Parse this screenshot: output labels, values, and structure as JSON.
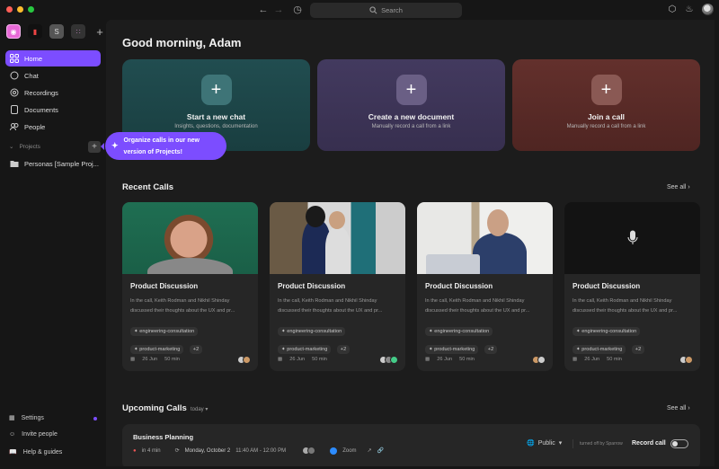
{
  "window": {
    "search_placeholder": "Search"
  },
  "colors": {
    "accent": "#7c4dff",
    "chat_card": "#1e4a4c",
    "doc_card": "#3e3558",
    "call_card": "#5a2b28"
  },
  "sidebar": {
    "items": [
      {
        "label": "Home",
        "icon": "home-grid-icon",
        "active": true
      },
      {
        "label": "Chat",
        "icon": "chat-icon"
      },
      {
        "label": "Recordings",
        "icon": "recordings-icon"
      },
      {
        "label": "Documents",
        "icon": "documents-icon"
      },
      {
        "label": "People",
        "icon": "people-icon"
      }
    ],
    "projects_label": "Projects",
    "project_items": [
      {
        "label": "Personas [Sample Proj..."
      }
    ],
    "tooltip": "Organize calls in our new version of Projects!",
    "footer": [
      {
        "label": "Settings",
        "icon": "settings-icon"
      },
      {
        "label": "Invite people",
        "icon": "invite-icon"
      },
      {
        "label": "Help & guides",
        "icon": "help-icon"
      }
    ]
  },
  "main": {
    "greeting": "Good morning, Adam",
    "quick_actions": [
      {
        "title": "Start a new chat",
        "subtitle": "Insights, questions, documentation"
      },
      {
        "title": "Create a new document",
        "subtitle": "Manually record a call from a link"
      },
      {
        "title": "Join a call",
        "subtitle": "Manually record a call from a link"
      }
    ],
    "recent_title": "Recent Calls",
    "see_all": "See all",
    "recent_calls": [
      {
        "title": "Product Discussion",
        "desc": "In the call, Keith Rodman and Nikhil Shinday discussed their thoughts about the UX and pr...",
        "tags": [
          "engineering-consultation",
          "product-marketing",
          "+2"
        ],
        "date": "26 Jun",
        "duration": "50 min"
      },
      {
        "title": "Product Discussion",
        "desc": "In the call, Keith Rodman and Nikhil Shinday discussed their thoughts about the UX and pr...",
        "tags": [
          "engineering-consultation",
          "product-marketing",
          "+2"
        ],
        "date": "26 Jun",
        "duration": "50 min"
      },
      {
        "title": "Product Discussion",
        "desc": "In the call, Keith Rodman and Nikhil Shinday discussed their thoughts about the UX and pr...",
        "tags": [
          "engineering-consultation",
          "product-marketing",
          "+2"
        ],
        "date": "26 Jun",
        "duration": "50 min"
      },
      {
        "title": "Product Discussion",
        "desc": "In the call, Keith Rodman and Nikhil Shinday discussed their thoughts about the UX and pr...",
        "tags": [
          "engineering-consultation",
          "product-marketing",
          "+2"
        ],
        "date": "26 Jun",
        "duration": "50 min"
      }
    ],
    "upcoming_title": "Upcoming Calls",
    "upcoming_filter": "today",
    "upcoming": {
      "title": "Business Planning",
      "countdown": "in 4 min",
      "date": "Monday, October 2",
      "time": "11:40 AM - 12:00 PM",
      "platform": "Zoom",
      "visibility": "Public",
      "turned_off_note": "turned off by Sparrow",
      "record_label": "Record call",
      "record_on": false
    }
  }
}
